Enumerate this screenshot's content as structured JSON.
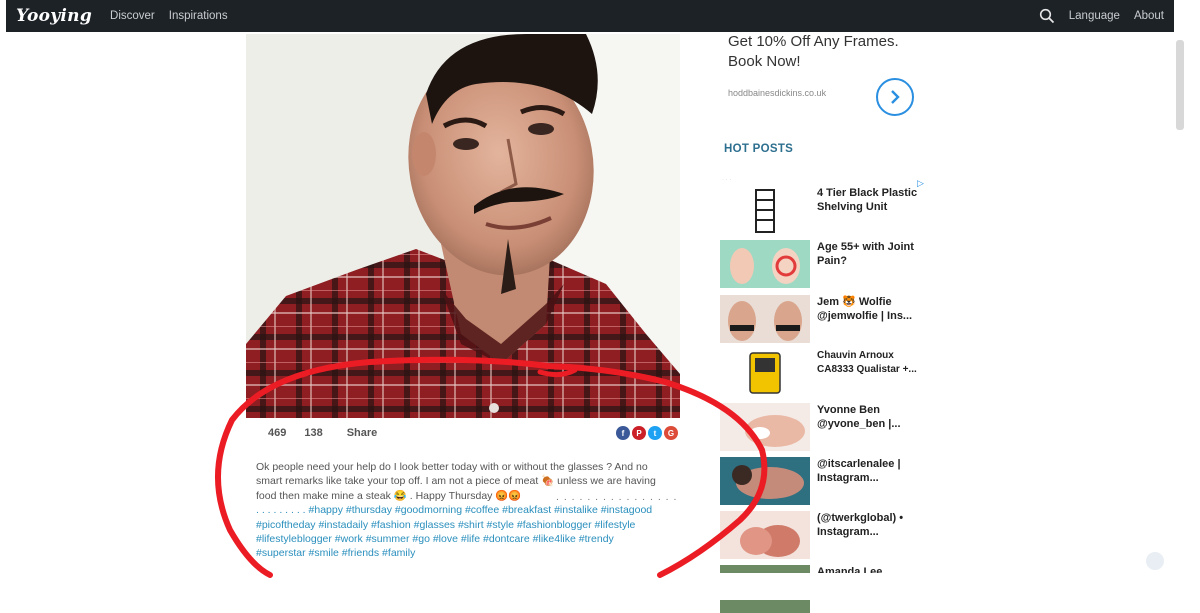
{
  "nav": {
    "logo": "Yooying",
    "links": [
      "Discover",
      "Inspirations"
    ],
    "language": "Language",
    "about": "About",
    "search_icon": "search-icon"
  },
  "post": {
    "likes": "469",
    "comments": "138",
    "share_label": "Share",
    "social_icons": [
      "facebook-icon",
      "pinterest-icon",
      "twitter-icon",
      "google-plus-icon"
    ],
    "caption_text": "Ok people need your help do I look better today with or without the glasses ? And no smart remarks like take your top off. I am not a piece of meat 🍖 unless we are having food then make mine a steak 😂 . Happy Thursday 😡😡",
    "caption_dots": ". . . . . . . . . . . . . . . . . . . . . . . . . . . . . . . . . . . . . . . .",
    "hashtags_line1": ". . . . . . . . . #happy #thursday #goodmorning #coffee #breakfast #instalike #instagood",
    "hashtags_line2": "#picoftheday #instadaily #fashion #glasses #shirt #style #fashionblogger #lifestyle",
    "hashtags_line3": "#lifestyleblogger #work #summer #go #love #life #dontcare #like4like #trendy",
    "hashtags_line4": "#superstar #smile #friends #family"
  },
  "sidebar": {
    "ad_headline": "Get 10% Off Any Frames. Book Now!",
    "ad_domain": "hoddbainesdickins.co.uk",
    "hot_posts_title": "HOT POSTS",
    "hot_posts": [
      {
        "title": "4 Tier Black Plastic Shelving Unit"
      },
      {
        "title": "Age 55+ with Joint Pain?"
      },
      {
        "title": "Jem 🐯 Wolfie @jemwolfie | Ins..."
      },
      {
        "title": "Chauvin Arnoux CA8333 Qualistar +..."
      },
      {
        "title": "Yvonne Ben @yvone_ben |..."
      },
      {
        "title": "@itscarlenalee | Instagram..."
      },
      {
        "title": "(@twerkglobal) • Instagram..."
      },
      {
        "title": "Amanda Lee"
      }
    ]
  },
  "colors": {
    "navbar": "#1d2227",
    "hashtag": "#2a8fbd",
    "annotation": "#ec1c24",
    "hot_posts_title": "#2d6f8f"
  }
}
